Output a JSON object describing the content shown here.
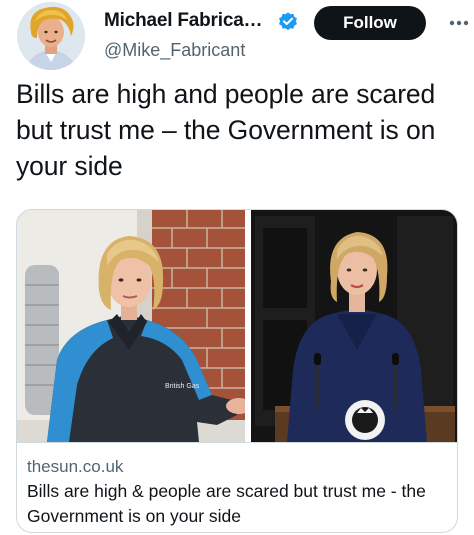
{
  "tweet": {
    "author": {
      "display_name": "Michael Fabrica…",
      "handle": "@Mike_Fabricant",
      "verified": true
    },
    "follow_label": "Follow",
    "text": "Bills are high and people are scared but trust me – the Government is on your side",
    "card": {
      "domain": "thesun.co.uk",
      "title": "Bills are high & people are scared but trust me - the Government is on your side",
      "jacket_text": "British Gas"
    }
  },
  "colors": {
    "text_primary": "#0f1419",
    "text_secondary": "#536471",
    "follow_bg": "#0f1419",
    "verified_blue": "#1d9bf0",
    "border": "#cfd9de"
  },
  "icons": {
    "verified": "verified-badge-icon",
    "more": "more-dots-icon"
  }
}
